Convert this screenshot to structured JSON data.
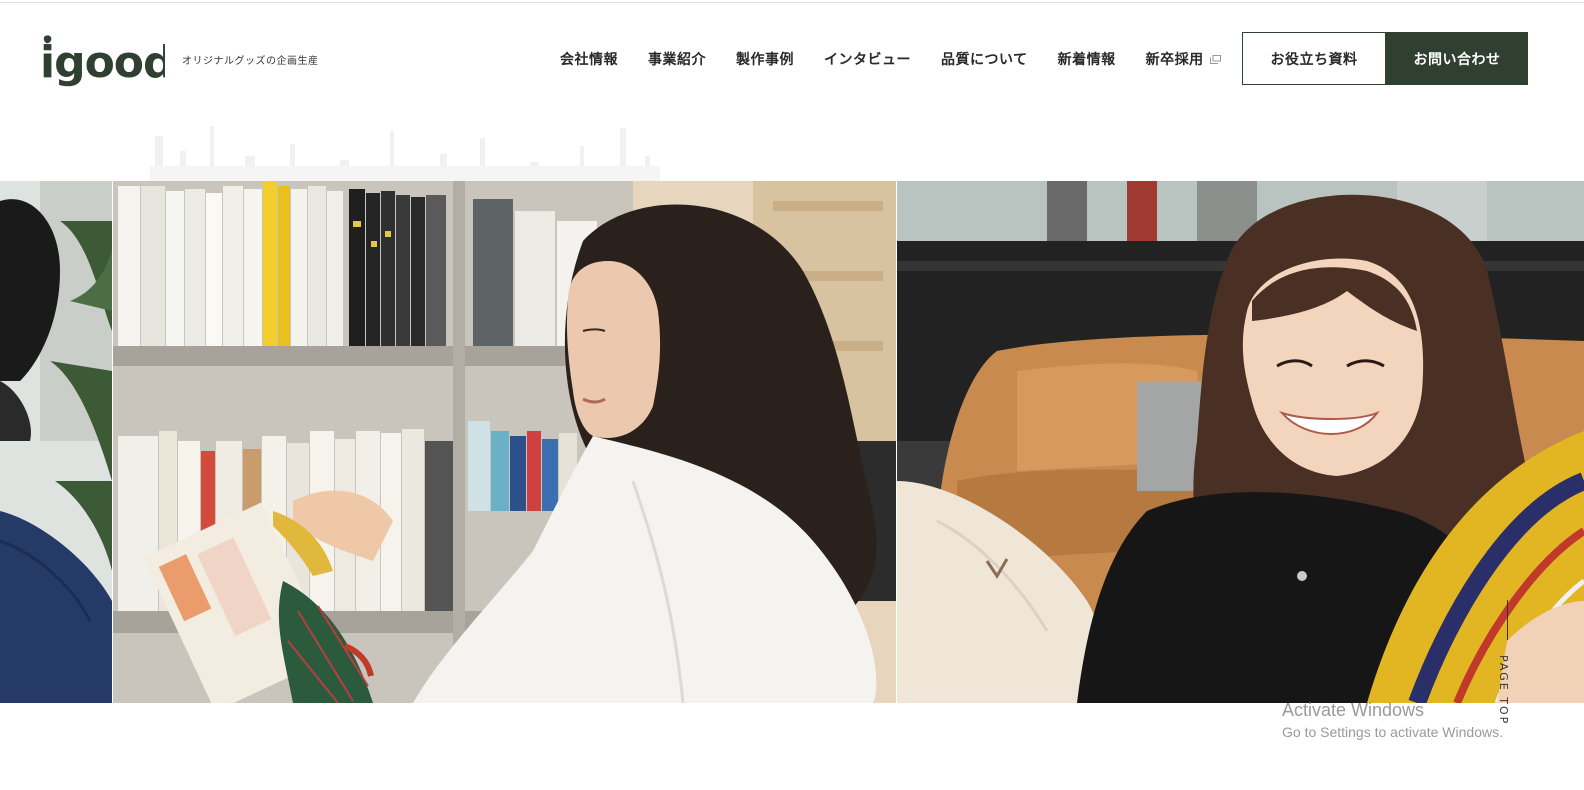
{
  "brand": {
    "logo_text": "igoods",
    "tagline": "オリジナルグッズの企画生産",
    "accent_color": "#2f3f30"
  },
  "nav": {
    "items": [
      {
        "label": "会社情報"
      },
      {
        "label": "事業紹介"
      },
      {
        "label": "製作事例"
      },
      {
        "label": "インタビュー"
      },
      {
        "label": "品質について"
      },
      {
        "label": "新着情報"
      },
      {
        "label": "新卒採用",
        "icon": "external-link-icon"
      }
    ]
  },
  "cta": {
    "docs_label": "お役立ち資料",
    "contact_label": "お問い合わせ"
  },
  "page_top": {
    "label": "PAGE TOP"
  },
  "watermark": {
    "title": "Activate Windows",
    "subtitle": "Go to Settings to activate Windows."
  }
}
